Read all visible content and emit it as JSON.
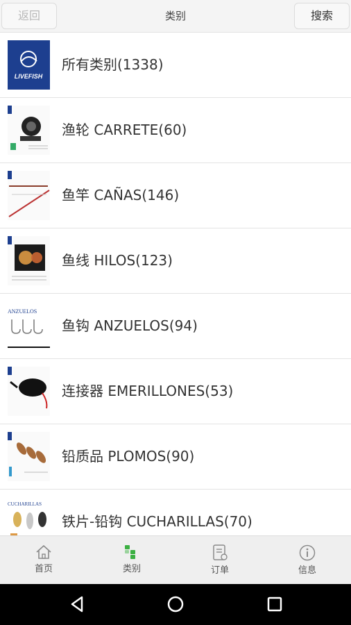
{
  "header": {
    "back_label": "返回",
    "title": "类别",
    "search_label": "搜索"
  },
  "categories": [
    {
      "label": "所有类别(1338)",
      "thumb_text": "LIVEFISH"
    },
    {
      "label": "渔轮 CARRETE(60)"
    },
    {
      "label": "鱼竿 CAÑAS(146)"
    },
    {
      "label": "鱼线 HILOS(123)"
    },
    {
      "label": "鱼钩 ANZUELOS(94)",
      "thumb_text": "ANZUELOS"
    },
    {
      "label": "连接器 EMERILLONES(53)"
    },
    {
      "label": "铅质品 PLOMOS(90)"
    },
    {
      "label": "铁片-铅钩 CUCHARILLAS(70)",
      "thumb_text": "CUCHARILLAS"
    }
  ],
  "tabs": [
    {
      "label": "首页",
      "icon": "home-icon"
    },
    {
      "label": "类别",
      "icon": "category-icon"
    },
    {
      "label": "订单",
      "icon": "order-icon"
    },
    {
      "label": "信息",
      "icon": "info-icon"
    }
  ],
  "colors": {
    "accent_green": "#3cb043",
    "logo_blue": "#1d3f8f"
  }
}
